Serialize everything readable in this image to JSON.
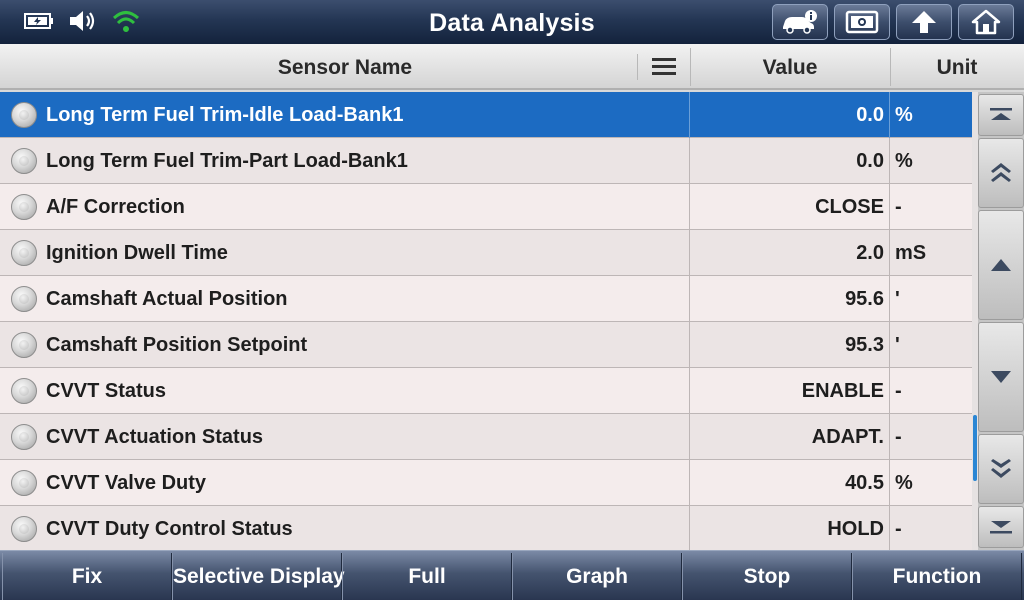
{
  "app": {
    "title": "Data Analysis"
  },
  "status_bar": {
    "battery_icon": "battery-icon",
    "volume_icon": "speaker-icon",
    "wifi_icon": "wifi-icon",
    "wifi_color": "#2fbf3f"
  },
  "top_buttons": [
    {
      "name": "vehicle-info-button",
      "icon": "car-info-icon"
    },
    {
      "name": "screenshot-button",
      "icon": "camera-icon"
    },
    {
      "name": "back-button",
      "icon": "up-arrow-icon"
    },
    {
      "name": "home-button",
      "icon": "home-icon"
    }
  ],
  "columns": {
    "name": "Sensor Name",
    "value": "Value",
    "unit": "Unit"
  },
  "rows": [
    {
      "name": "Long Term Fuel Trim-Idle Load-Bank1",
      "value": "0.0",
      "unit": "%",
      "selected": true
    },
    {
      "name": "Long Term Fuel Trim-Part Load-Bank1",
      "value": "0.0",
      "unit": "%"
    },
    {
      "name": "A/F Correction",
      "value": "CLOSE",
      "unit": "-"
    },
    {
      "name": "Ignition Dwell Time",
      "value": "2.0",
      "unit": "mS"
    },
    {
      "name": "Camshaft Actual Position",
      "value": "95.6",
      "unit": "'"
    },
    {
      "name": "Camshaft Position Setpoint",
      "value": "95.3",
      "unit": "'"
    },
    {
      "name": "CVVT Status",
      "value": "ENABLE",
      "unit": "-"
    },
    {
      "name": "CVVT Actuation Status",
      "value": "ADAPT.",
      "unit": "-"
    },
    {
      "name": "CVVT Valve Duty",
      "value": "40.5",
      "unit": "%"
    },
    {
      "name": "CVVT Duty Control Status",
      "value": "HOLD",
      "unit": "-"
    }
  ],
  "side_buttons": [
    "scroll-top-icon",
    "page-up-icon",
    "line-up-icon",
    "line-down-icon",
    "page-down-icon",
    "scroll-bottom-icon"
  ],
  "toolbar": {
    "fix": "Fix",
    "selective_display": "Selective Display",
    "full": "Full",
    "graph": "Graph",
    "stop": "Stop",
    "function": "Function"
  },
  "colors": {
    "selected_row": "#1c6bc2",
    "scroll_thumb": "#2a86d4"
  }
}
